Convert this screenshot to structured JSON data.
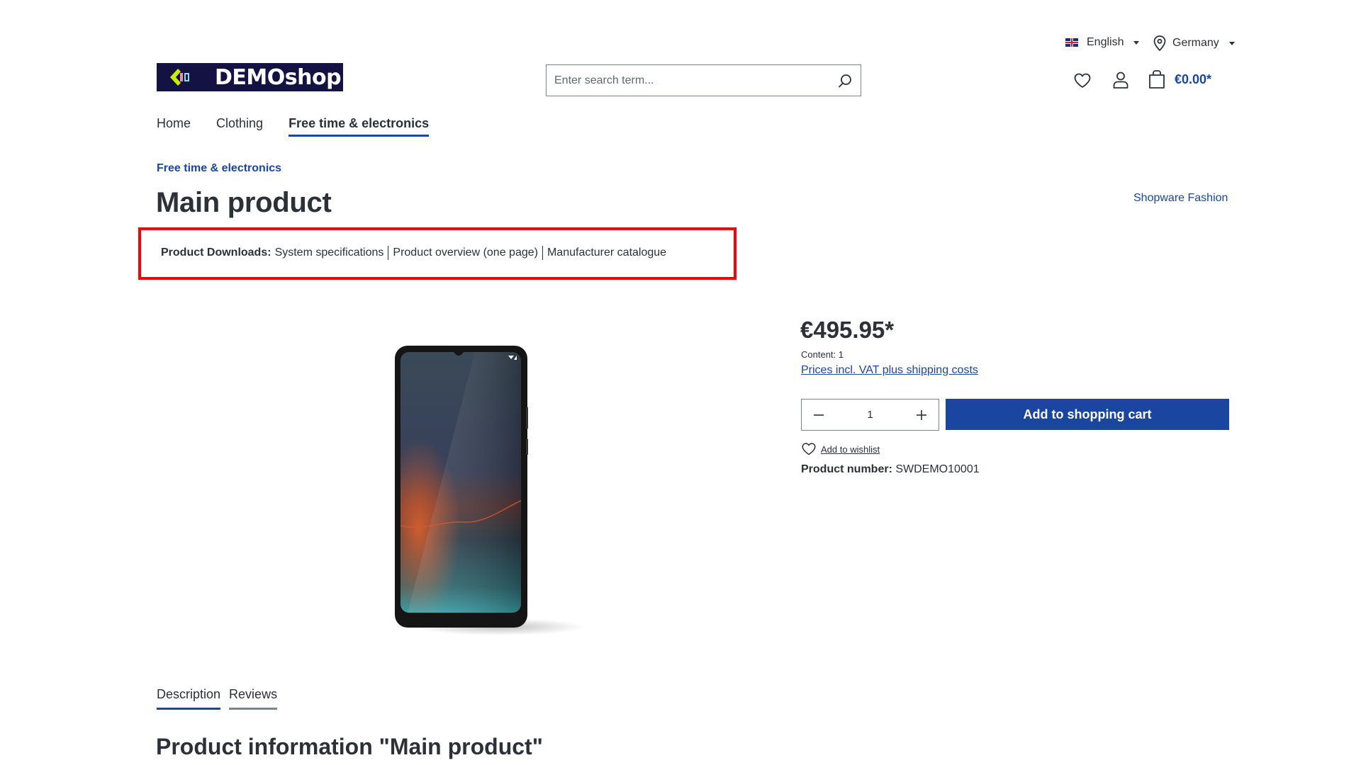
{
  "topbar": {
    "language": {
      "label": "English",
      "flag": "uk-flag-icon"
    },
    "country": {
      "label": "Germany",
      "icon": "map-pin-icon"
    }
  },
  "header": {
    "logo_text": "DEMOshop",
    "search": {
      "placeholder": "Enter search term...",
      "value": ""
    },
    "actions": {
      "wishlist_icon": "heart-icon",
      "account_icon": "user-icon",
      "cart_icon": "shopping-bag-icon",
      "cart_total": "€0.00*"
    }
  },
  "nav": {
    "items": [
      {
        "label": "Home",
        "active": false
      },
      {
        "label": "Clothing",
        "active": false
      },
      {
        "label": "Free time & electronics",
        "active": true
      }
    ]
  },
  "breadcrumb": "Free time & electronics",
  "product": {
    "title": "Main product",
    "manufacturer": "Shopware Fashion",
    "downloads": {
      "label": "Product Downloads:",
      "links": [
        "System specifications",
        "Product overview (one page)",
        "Manufacturer catalogue"
      ]
    },
    "image_alt": "Smartphone",
    "price": "€495.95*",
    "content": "Content: 1",
    "vat_link": "Prices incl. VAT plus shipping costs",
    "quantity": "1",
    "add_to_cart": "Add to shopping cart",
    "add_to_wishlist": "Add to wishlist",
    "product_number_label": "Product number:",
    "product_number": "SWDEMO10001"
  },
  "tabs": [
    {
      "label": "Description",
      "active": true
    },
    {
      "label": "Reviews",
      "active": false
    }
  ],
  "info_heading": "Product information \"Main product\"",
  "colors": {
    "primary": "#1a46a0",
    "text": "#2b3136",
    "logo_bg": "#141243",
    "highlight_border": "#ff0000"
  }
}
